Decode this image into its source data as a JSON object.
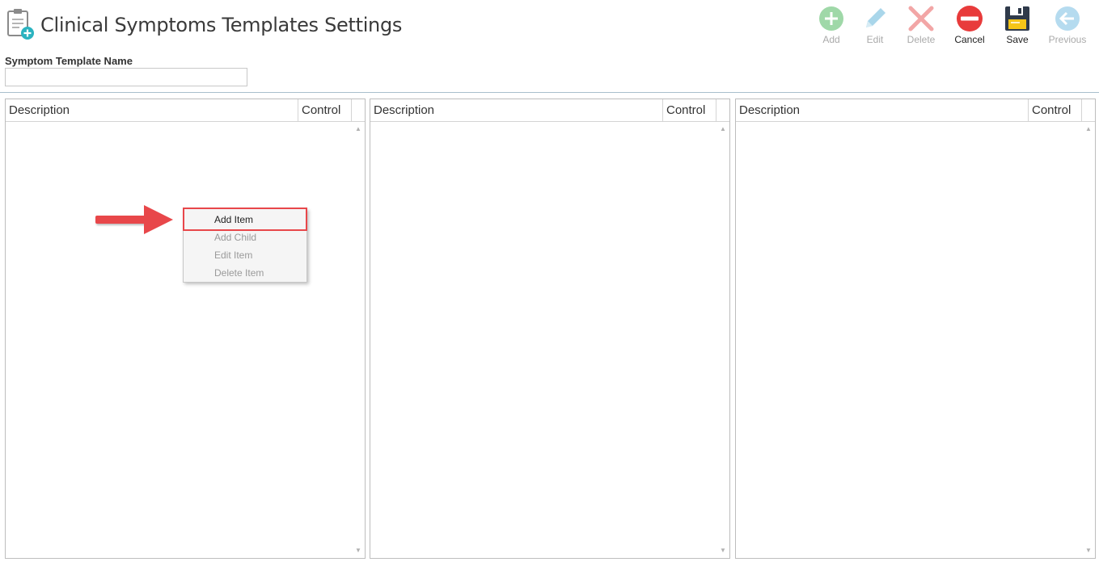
{
  "header": {
    "title": "Clinical Symptoms Templates Settings",
    "icon": "document-add-icon"
  },
  "toolbar": {
    "buttons": [
      {
        "id": "add",
        "label": "Add",
        "icon": "plus-circle-icon",
        "enabled": false,
        "color": "#9fd8a8"
      },
      {
        "id": "edit",
        "label": "Edit",
        "icon": "pencil-icon",
        "enabled": false,
        "color": "#a9d6ea"
      },
      {
        "id": "delete",
        "label": "Delete",
        "icon": "x-icon",
        "enabled": false,
        "color": "#f2a6a6"
      },
      {
        "id": "cancel",
        "label": "Cancel",
        "icon": "no-entry-icon",
        "enabled": true,
        "color": "#e83b3b"
      },
      {
        "id": "save",
        "label": "Save",
        "icon": "floppy-disk-icon",
        "enabled": true,
        "color": "#2f3a4a"
      },
      {
        "id": "previous",
        "label": "Previous",
        "icon": "arrow-left-circle-icon",
        "enabled": false,
        "color": "#b5dbef"
      }
    ]
  },
  "form": {
    "template_name_label": "Symptom Template Name",
    "template_name_value": "",
    "template_name_placeholder": ""
  },
  "panels": [
    {
      "columns": [
        "Description",
        "Control"
      ]
    },
    {
      "columns": [
        "Description",
        "Control"
      ]
    },
    {
      "columns": [
        "Description",
        "Control"
      ]
    }
  ],
  "context_menu": {
    "items": [
      {
        "label": "Add Item",
        "enabled": true
      },
      {
        "label": "Add Child",
        "enabled": false
      },
      {
        "label": "Edit Item",
        "enabled": false
      },
      {
        "label": "Delete Item",
        "enabled": false
      }
    ]
  },
  "annotation": {
    "arrow_color": "#e8474a",
    "highlight_color": "#e8474a"
  }
}
